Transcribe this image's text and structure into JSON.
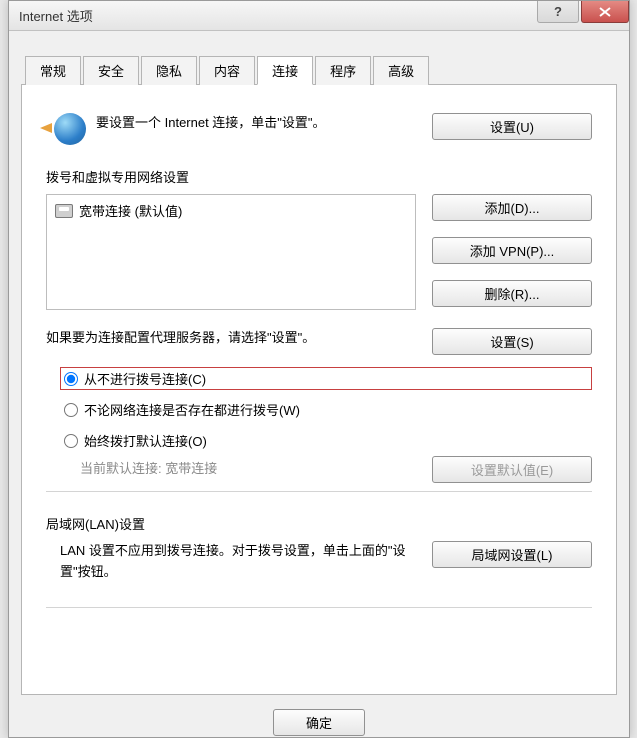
{
  "title": "Internet 选项",
  "tabs": [
    "常规",
    "安全",
    "隐私",
    "内容",
    "连接",
    "程序",
    "高级"
  ],
  "activeTab": 4,
  "setupText": "要设置一个 Internet 连接，单击\"设置\"。",
  "setupBtn": "设置(U)",
  "dialSection": "拨号和虚拟专用网络设置",
  "connection": "宽带连接 (默认值)",
  "addBtn": "添加(D)...",
  "addVpnBtn": "添加 VPN(P)...",
  "removeBtn": "删除(R)...",
  "proxyText": "如果要为连接配置代理服务器，请选择\"设置\"。",
  "settingsBtn": "设置(S)",
  "radio1": "从不进行拨号连接(C)",
  "radio2": "不论网络连接是否存在都进行拨号(W)",
  "radio3": "始终拨打默认连接(O)",
  "currentDefault": "当前默认连接: 宽带连接",
  "setDefaultBtn": "设置默认值(E)",
  "lanSection": "局域网(LAN)设置",
  "lanText": "LAN 设置不应用到拨号连接。对于拨号设置，单击上面的\"设置\"按钮。",
  "lanBtn": "局域网设置(L)",
  "okBtn": "确定"
}
